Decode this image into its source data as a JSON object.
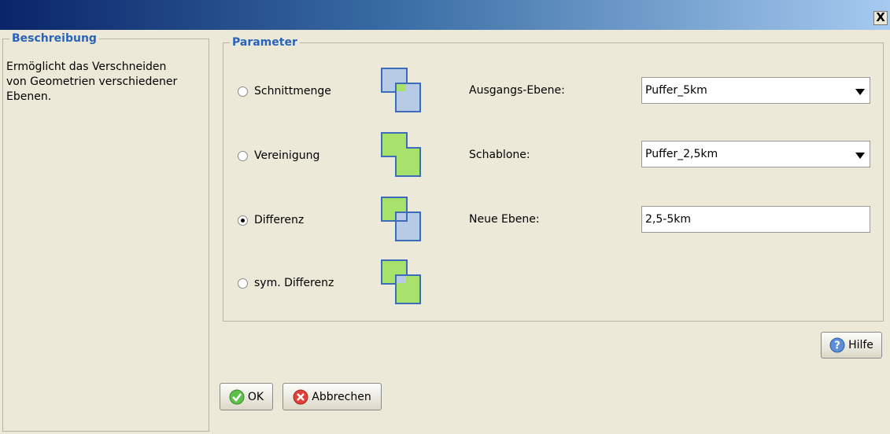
{
  "window": {
    "close_label": "X"
  },
  "description": {
    "legend": "Beschreibung",
    "text_lines": [
      "Ermöglicht das Verschneiden",
      "von Geometrien verschiedener",
      "Ebenen."
    ]
  },
  "parameters": {
    "legend": "Parameter",
    "operations": [
      {
        "label": "Schnittmenge",
        "selected": false,
        "icon": "intersection-icon"
      },
      {
        "label": "Vereinigung",
        "selected": false,
        "icon": "union-icon"
      },
      {
        "label": "Differenz",
        "selected": true,
        "icon": "difference-icon"
      },
      {
        "label": "sym. Differenz",
        "selected": false,
        "icon": "sym-difference-icon"
      }
    ],
    "source_layer": {
      "label": "Ausgangs-Ebene:",
      "value": "Puffer_5km"
    },
    "template_layer": {
      "label": "Schablone:",
      "value": "Puffer_2,5km"
    },
    "new_layer": {
      "label": "Neue Ebene:",
      "value": "2,5-5km"
    }
  },
  "buttons": {
    "help": "Hilfe",
    "ok": "OK",
    "cancel": "Abbrechen"
  },
  "colors": {
    "title_start": "#0a246a",
    "title_end": "#a6caf0",
    "legend": "#2a64b8",
    "fill_blue": "#b8cbe6",
    "fill_green": "#a9e26a",
    "outline": "#3d6db8"
  }
}
